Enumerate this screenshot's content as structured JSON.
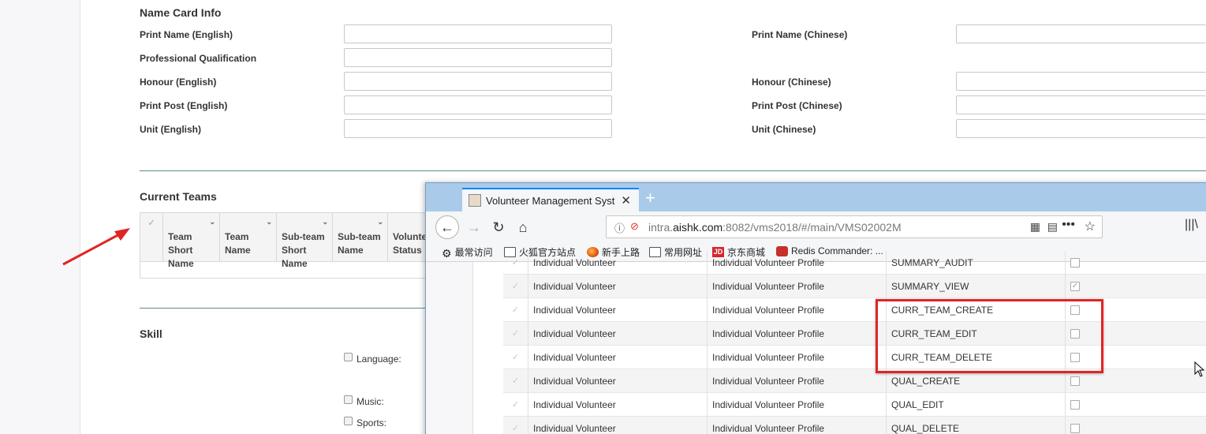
{
  "name_card": {
    "title": "Name Card Info",
    "fields_left": [
      {
        "label": "Print Name (English)",
        "value": ""
      },
      {
        "label": "Professional Qualification",
        "value": ""
      },
      {
        "label": "Honour (English)",
        "value": ""
      },
      {
        "label": "Print Post (English)",
        "value": ""
      },
      {
        "label": "Unit (English)",
        "value": ""
      }
    ],
    "fields_right": [
      {
        "label": "Print Name (Chinese)",
        "value": ""
      },
      {
        "label": "Honour (Chinese)",
        "value": ""
      },
      {
        "label": "Print Post (Chinese)",
        "value": ""
      },
      {
        "label": "Unit (Chinese)",
        "value": ""
      }
    ]
  },
  "current_teams": {
    "title": "Current Teams",
    "columns": [
      {
        "label": "Team\nShort\nName"
      },
      {
        "label": "Team\nName"
      },
      {
        "label": "Sub-team\nShort\nName"
      },
      {
        "label": "Sub-team\nName"
      },
      {
        "label": "Volunteer\nStatus"
      }
    ]
  },
  "skill": {
    "title": "Skill",
    "options": [
      {
        "label": "Language:",
        "checked": false
      },
      {
        "label": "Music:",
        "checked": false
      },
      {
        "label": "Sports:",
        "checked": false
      }
    ]
  },
  "browser": {
    "tab_title": "Volunteer Management Syst",
    "url_host_prefix": "intra.",
    "url_host": "aishk.com",
    "url_rest": ":8082/vms2018/#/main/VMS02002M",
    "bookmarks": [
      {
        "label": "最常访问",
        "icon": "gear-icon"
      },
      {
        "label": "火狐官方站点",
        "icon": "folder-icon"
      },
      {
        "label": "新手上路",
        "icon": "firefox-icon"
      },
      {
        "label": "常用网址",
        "icon": "folder-icon"
      },
      {
        "label": "京东商城",
        "icon": "jd-icon"
      },
      {
        "label": "Redis Commander: ...",
        "icon": "redis-icon"
      }
    ]
  },
  "permissions": {
    "rows": [
      {
        "role": "Individual Volunteer",
        "module": "Individual Volunteer Profile",
        "permission": "SUMMARY_AUDIT",
        "checked": false
      },
      {
        "role": "Individual Volunteer",
        "module": "Individual Volunteer Profile",
        "permission": "SUMMARY_VIEW",
        "checked": true
      },
      {
        "role": "Individual Volunteer",
        "module": "Individual Volunteer Profile",
        "permission": "CURR_TEAM_CREATE",
        "checked": false
      },
      {
        "role": "Individual Volunteer",
        "module": "Individual Volunteer Profile",
        "permission": "CURR_TEAM_EDIT",
        "checked": false
      },
      {
        "role": "Individual Volunteer",
        "module": "Individual Volunteer Profile",
        "permission": "CURR_TEAM_DELETE",
        "checked": false
      },
      {
        "role": "Individual Volunteer",
        "module": "Individual Volunteer Profile",
        "permission": "QUAL_CREATE",
        "checked": false
      },
      {
        "role": "Individual Volunteer",
        "module": "Individual Volunteer Profile",
        "permission": "QUAL_EDIT",
        "checked": false
      },
      {
        "role": "Individual Volunteer",
        "module": "Individual Volunteer Profile",
        "permission": "QUAL_DELETE",
        "checked": false
      }
    ]
  },
  "colors": {
    "divider": "#5a8f8a",
    "annotation_red": "#e02424",
    "tabbar": "#a9cbe9"
  }
}
